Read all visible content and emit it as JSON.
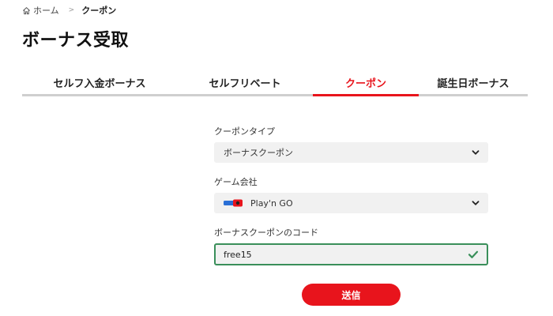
{
  "breadcrumb": {
    "home": "ホーム",
    "separator": ">",
    "current": "クーポン"
  },
  "page": {
    "title": "ボーナス受取"
  },
  "tabs": [
    {
      "label": "セルフ入金ボーナス",
      "active": false
    },
    {
      "label": "セルフリベート",
      "active": false
    },
    {
      "label": "クーポン",
      "active": true
    },
    {
      "label": "誕生日ボーナス",
      "active": false
    }
  ],
  "form": {
    "coupon_type": {
      "label": "クーポンタイプ",
      "value": "ボーナスクーポン"
    },
    "game_provider": {
      "label": "ゲーム会社",
      "value": "Play'n GO"
    },
    "coupon_code": {
      "label": "ボーナスクーポンのコード",
      "value": "free15",
      "valid": true
    },
    "submit_label": "送信"
  },
  "colors": {
    "accent": "#e8141c",
    "valid": "#3a8f5a",
    "field_bg": "#f1f1f1"
  },
  "icons": {
    "home": "home-icon",
    "chevron": "chevron-down-icon",
    "check": "check-icon",
    "provider": "playngo-logo"
  }
}
